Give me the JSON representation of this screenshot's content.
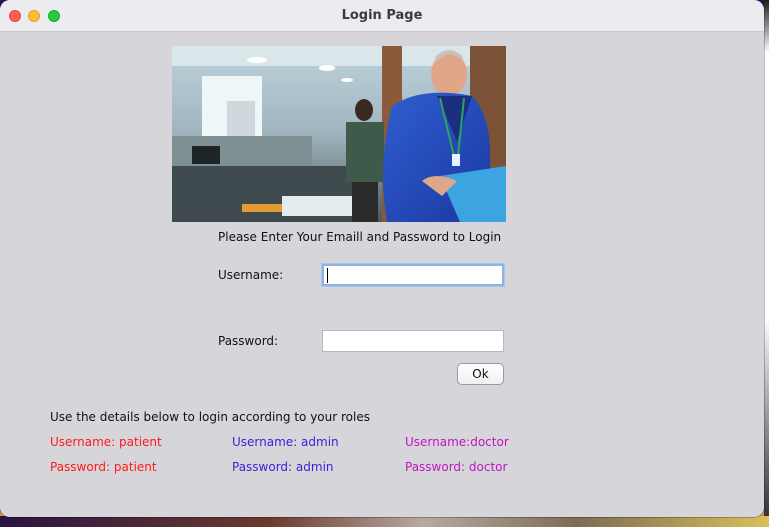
{
  "window": {
    "title": "Login Page"
  },
  "image": {
    "description_icon": "doctor-photo"
  },
  "prompt": "Please Enter Your Emaill and Password to Login",
  "form": {
    "username_label": "Username:",
    "username_value": "",
    "password_label": "Password:",
    "password_value": "",
    "ok_label": "Ok"
  },
  "info_text": "Use the details below to login according to your roles",
  "credentials": {
    "patient": {
      "username": "Username: patient",
      "password": "Password: patient",
      "color": "#ff1a1a"
    },
    "admin": {
      "username": "Username: admin",
      "password": "Password: admin",
      "color": "#3a1fd6"
    },
    "doctor": {
      "username": "Username:doctor",
      "password": "Password: doctor",
      "color": "#c015c0"
    }
  }
}
